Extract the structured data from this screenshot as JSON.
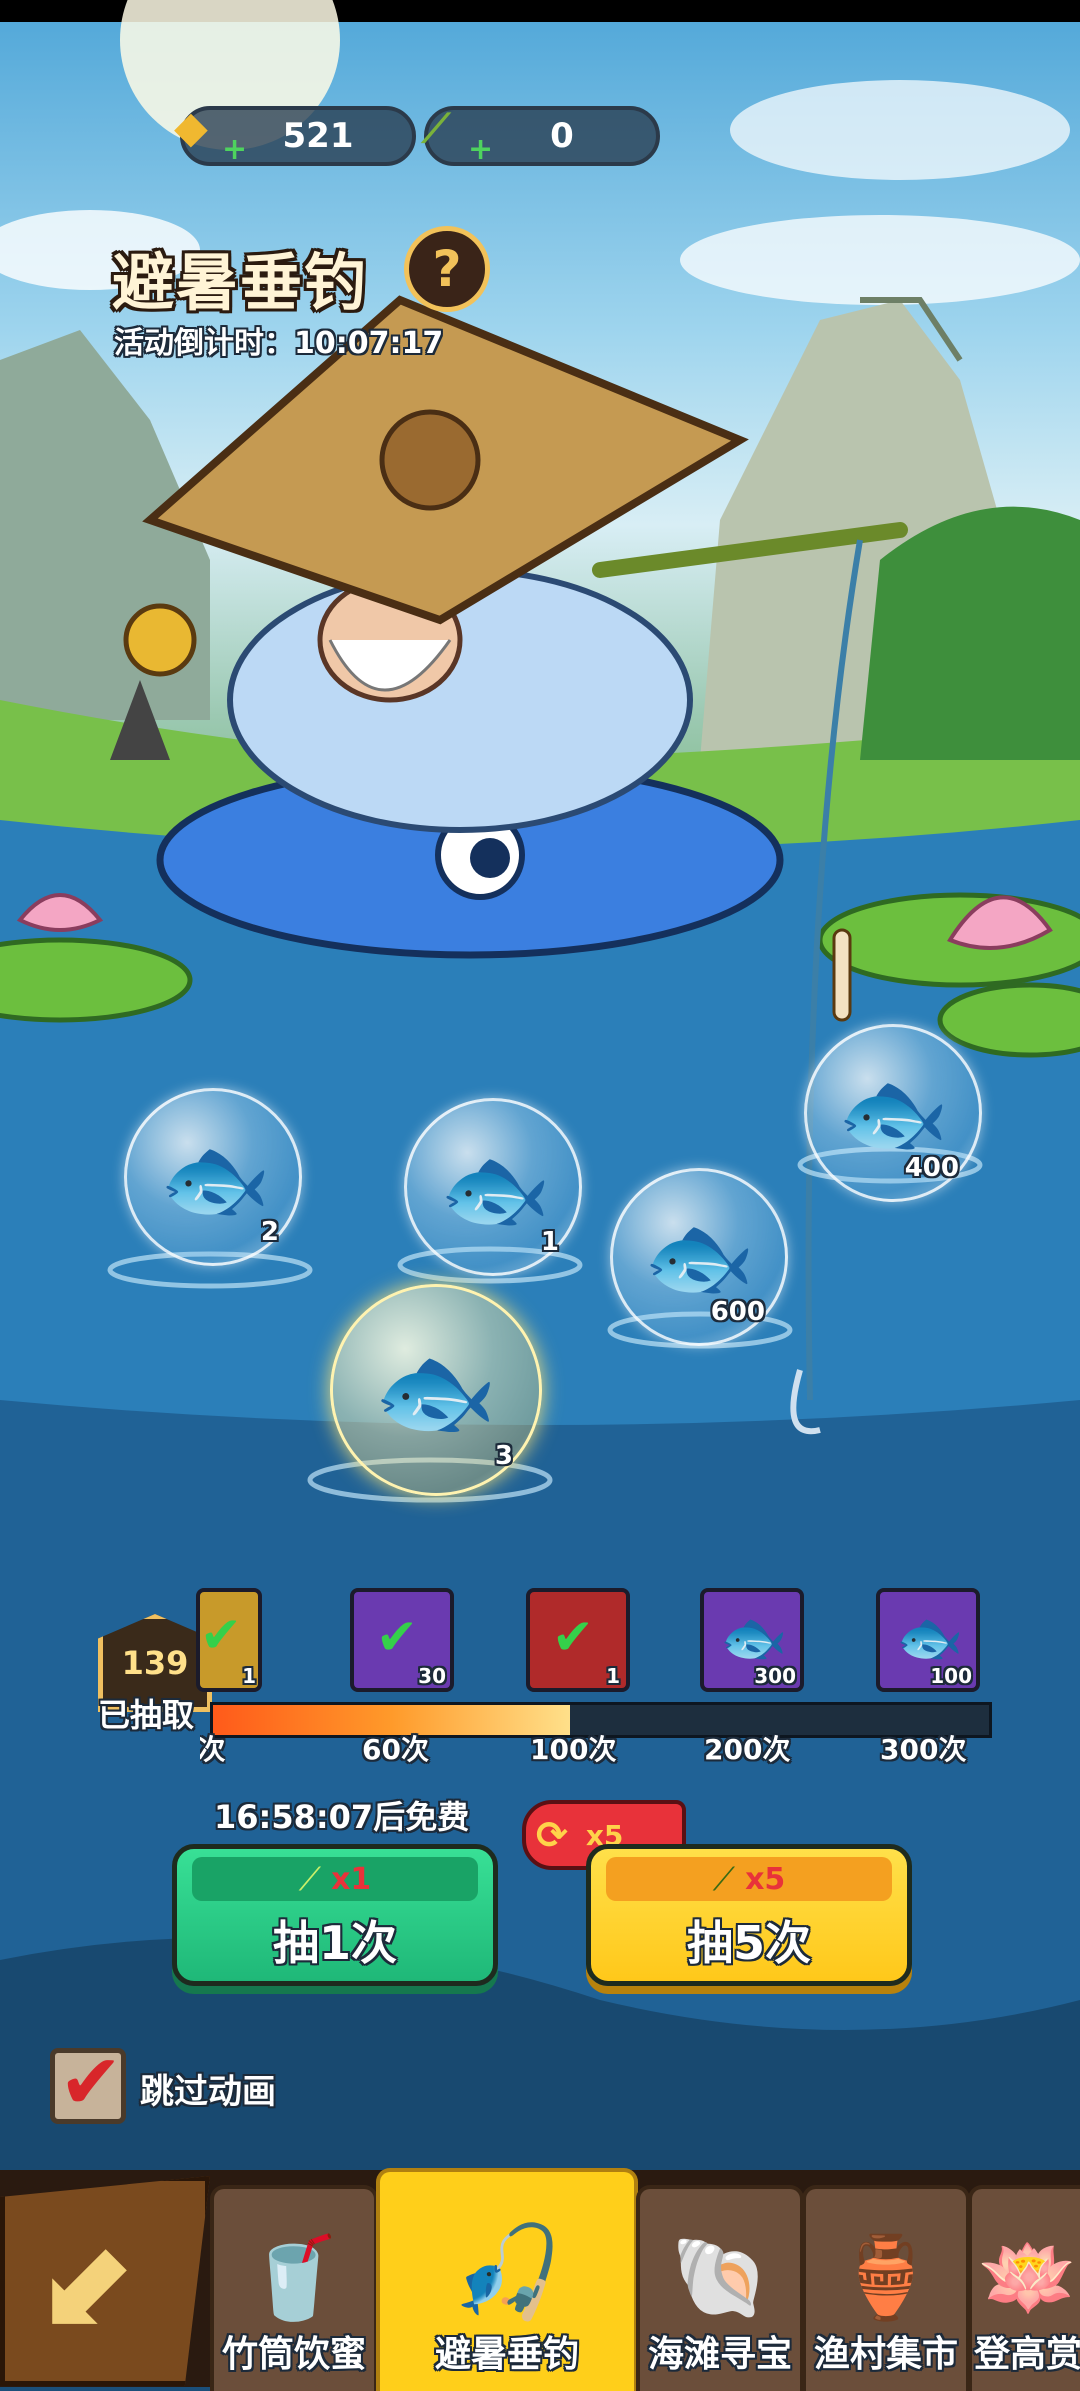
{
  "currencies": {
    "gold_ingot": "521",
    "fishing_rod": "0"
  },
  "event": {
    "title": "避暑垂钓",
    "countdown_label": "活动倒计时：",
    "countdown_value": "10:07:17"
  },
  "fish_bubbles": [
    {
      "qty": "2",
      "type": "gold"
    },
    {
      "qty": "1",
      "type": "gold"
    },
    {
      "qty": "600",
      "type": "red"
    },
    {
      "qty": "400",
      "type": "red"
    },
    {
      "qty": "3",
      "type": "gold",
      "selected": true
    }
  ],
  "draw_progress": {
    "count": "139",
    "label": "已抽取",
    "fill_fraction": 0.46,
    "rewards": [
      {
        "qty": "1",
        "claimed": true
      },
      {
        "qty": "30",
        "claimed": true
      },
      {
        "qty": "1",
        "claimed": true
      },
      {
        "qty": "300",
        "claimed": false
      },
      {
        "qty": "100",
        "claimed": false
      }
    ],
    "milestones": [
      "0次",
      "60次",
      "100次",
      "200次",
      "300次"
    ]
  },
  "free_timer": "16:58:07后免费",
  "multiplier_badge": "x5",
  "buttons": {
    "draw1": {
      "cost": "x1",
      "label": "抽1次"
    },
    "draw5": {
      "cost": "x5",
      "label": "抽5次"
    }
  },
  "skip_animation": {
    "checked": true,
    "label": "跳过动画"
  },
  "bottom_nav": {
    "back_icon": "back-arrow-icon",
    "tabs": [
      {
        "label": "竹筒饮蜜",
        "icon": "bamboo-drink-icon",
        "active": false
      },
      {
        "label": "避暑垂钓",
        "icon": "fishing-icon",
        "active": true
      },
      {
        "label": "海滩寻宝",
        "icon": "shell-pearl-icon",
        "active": false
      },
      {
        "label": "渔村集市",
        "icon": "market-jar-icon",
        "active": false
      },
      {
        "label": "登高赏",
        "icon": "lotus-icon",
        "active": false
      }
    ]
  },
  "colors": {
    "green_button": "#2fd08a",
    "yellow_button": "#ffd21f",
    "progress_fill": "#ff8a2a",
    "active_tab": "#ffcf1a"
  }
}
